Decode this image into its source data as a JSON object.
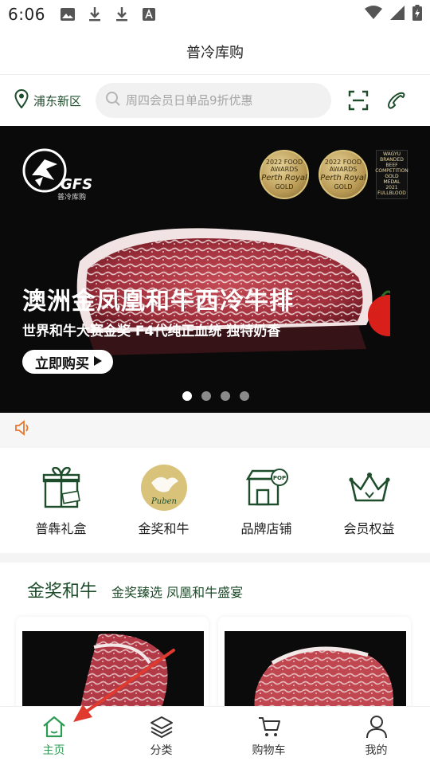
{
  "status_bar": {
    "time": "6:06",
    "left_icons": [
      "image-icon",
      "download-icon",
      "download-icon",
      "font-icon"
    ],
    "right_icons": [
      "wifi-icon",
      "signal-icon",
      "battery-charging-icon"
    ]
  },
  "header": {
    "title": "普冷库购"
  },
  "search_row": {
    "location": "浦东新区",
    "search_placeholder": "周四会员日单品9折优惠",
    "scan_icon": "scan-icon",
    "phone_icon": "phone-icon"
  },
  "banner": {
    "logo_text": "GFS",
    "logo_sub": "普冷库购",
    "medals": [
      {
        "line1": "2022 FOOD AWARDS",
        "line2": "Perth Royal",
        "line3": "GOLD"
      },
      {
        "line1": "2022 FOOD AWARDS",
        "line2": "Perth Royal",
        "line3": "GOLD"
      }
    ],
    "wagyu_badge": [
      "WAGYU",
      "BRANDED",
      "BEEF",
      "COMPETITION",
      "GOLD MEDAL",
      "2021",
      "FULLBLOOD"
    ],
    "title": "澳洲金凤凰和牛西冷牛排",
    "subtitle": "世界和牛大赛金奖 F4代纯正血统 独特奶香",
    "button": "立即购买",
    "slide_count": 4,
    "active_slide": 0
  },
  "notice": {
    "icon": "speaker-icon"
  },
  "categories": [
    {
      "label": "普犇礼盒",
      "icon": "gift-box-icon"
    },
    {
      "label": "金奖和牛",
      "icon": "puben-logo-icon"
    },
    {
      "label": "品牌店铺",
      "icon": "store-icon"
    },
    {
      "label": "会员权益",
      "icon": "crown-icon"
    }
  ],
  "section": {
    "title": "金奖和牛",
    "subtitle": "金奖臻选 凤凰和牛盛宴"
  },
  "puben_logo_text": "Puben",
  "tabs": [
    {
      "label": "主页",
      "icon": "home-icon",
      "active": true
    },
    {
      "label": "分类",
      "icon": "layers-icon",
      "active": false
    },
    {
      "label": "购物车",
      "icon": "cart-icon",
      "active": false
    },
    {
      "label": "我的",
      "icon": "user-icon",
      "active": false
    }
  ],
  "colors": {
    "brand_green": "#1e4d2b",
    "active_tab": "#2e9b54",
    "annotation_arrow": "#e03a2f",
    "notice_icon": "#e8772e"
  }
}
